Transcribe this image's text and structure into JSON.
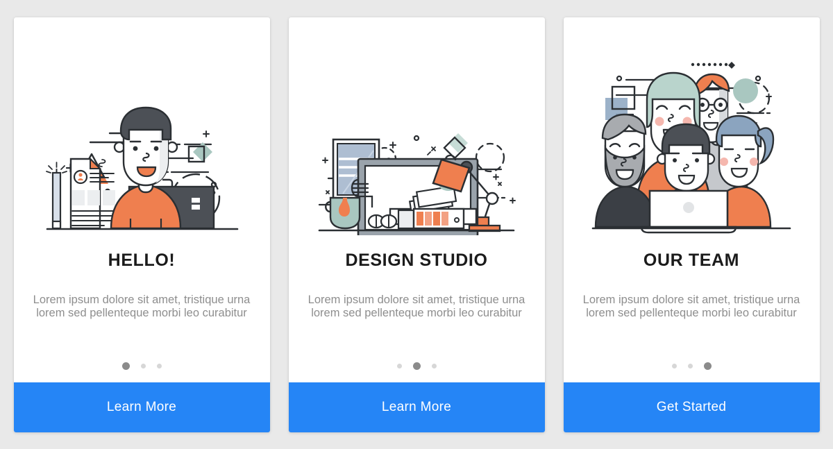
{
  "page": {
    "background_color": "#e9e9e9",
    "layout": "three-card onboarding carousel"
  },
  "theme": {
    "accent_blue": "#2585f6",
    "card_background": "#ffffff",
    "title_color": "#1b1b1b",
    "body_text_color": "#8e8e8e",
    "dot_active_color": "#8b8b8b",
    "dot_inactive_color": "#d7d7d7",
    "illustration_orange": "#ef7f4f",
    "illustration_dark": "#4c5056",
    "illustration_mint": "#a9c7c0",
    "illustration_gray": "#b9bcc1",
    "illustration_blue_gray": "#8ba4bf",
    "illustration_line": "#2b2f33"
  },
  "cards": [
    {
      "id": "card-hello",
      "illustration_name": "person-with-resume-and-briefcase-illustration",
      "illustration_alt": "Man with dark hair in orange shirt beside a resume document, pencil, briefcase, gear and triangle decorations",
      "title": "HELLO!",
      "description": "Lorem ipsum dolore sit amet, tristique urna lorem sed pellenteque morbi leo curabitur",
      "dots": {
        "count": 3,
        "active_index": 0
      },
      "cta_label": "Learn More"
    },
    {
      "id": "card-design-studio",
      "illustration_name": "desk-workspace-illustration",
      "illustration_alt": "Designer desk with monitor, orange desk lamp, coffee mug, color swatches, papers and a framed picture",
      "title": "DESIGN STUDIO",
      "description": "Lorem ipsum dolore sit amet, tristique urna lorem sed pellenteque morbi leo curabitur",
      "dots": {
        "count": 3,
        "active_index": 1
      },
      "cta_label": "Learn More"
    },
    {
      "id": "card-our-team",
      "illustration_name": "team-group-illustration",
      "illustration_alt": "Group of five team members around a laptop with geometric square and circle decorations",
      "title": "OUR TEAM",
      "description": "Lorem ipsum dolore sit amet, tristique urna lorem sed pellenteque morbi leo curabitur",
      "dots": {
        "count": 3,
        "active_index": 2
      },
      "cta_label": "Get Started"
    }
  ]
}
